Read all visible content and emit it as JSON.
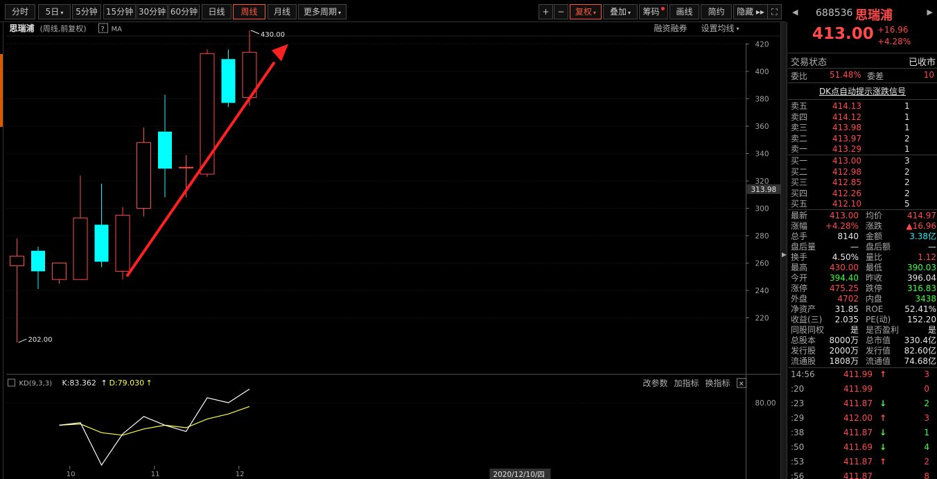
{
  "toolbar": {
    "left": [
      {
        "label": "分时",
        "active": false
      },
      {
        "label": "5日",
        "active": false,
        "dropdown": true
      },
      {
        "label": "5分钟",
        "active": false
      },
      {
        "label": "15分钟",
        "active": false
      },
      {
        "label": "30分钟",
        "active": false
      },
      {
        "label": "60分钟",
        "active": false
      },
      {
        "label": "日线",
        "active": false
      },
      {
        "label": "周线",
        "active": true
      },
      {
        "label": "月线",
        "active": false
      },
      {
        "label": "更多周期",
        "active": false,
        "dropdown": true
      }
    ],
    "right": [
      {
        "label": "+",
        "active": false
      },
      {
        "label": "−",
        "active": false
      },
      {
        "label": "复权",
        "active": true,
        "dropdown": true
      },
      {
        "label": "叠加",
        "active": false,
        "dropdown": true
      },
      {
        "label": "筹码",
        "active": false,
        "dot": true
      },
      {
        "label": "画线",
        "active": false
      },
      {
        "label": "简约",
        "active": false
      },
      {
        "label": "隐藏 ▸▸",
        "active": false
      },
      {
        "label": "⛶",
        "active": false
      }
    ]
  },
  "chart_header": {
    "name": "思瑞浦",
    "info": "(周线,前复权)",
    "help": "?",
    "ma": "MA",
    "margin": "融资融券",
    "settings": "设置均线"
  },
  "kd_header": {
    "label": "KD(9,3,3)",
    "k": "K:83.362",
    "d": "D:79.030",
    "btn1": "改参数",
    "btn2": "加指标",
    "btn3": "换指标",
    "close": "✕"
  },
  "chart_data": {
    "type": "candlestick",
    "ylim": [
      190,
      440
    ],
    "yticks": [
      220,
      240,
      260,
      280,
      300,
      320,
      340,
      360,
      380,
      400,
      420
    ],
    "current_price_label": "313.98",
    "high_label": "430.00",
    "low_label": "202.00",
    "xtick_labels": [
      {
        "label": "10",
        "index": 2.5
      },
      {
        "label": "11",
        "index": 6.5
      },
      {
        "label": "12",
        "index": 10.5
      }
    ],
    "date_label": "2020/12/10/四",
    "candles": [
      {
        "o": 258,
        "h": 278,
        "l": 202,
        "c": 265
      },
      {
        "o": 269,
        "h": 272,
        "l": 241,
        "c": 254
      },
      {
        "o": 248,
        "h": 260,
        "l": 245,
        "c": 260
      },
      {
        "o": 248,
        "h": 324,
        "l": 248,
        "c": 293
      },
      {
        "o": 288,
        "h": 318,
        "l": 257,
        "c": 261
      },
      {
        "o": 254,
        "h": 301,
        "l": 248,
        "c": 295
      },
      {
        "o": 300,
        "h": 359,
        "l": 294,
        "c": 348
      },
      {
        "o": 356,
        "h": 383,
        "l": 308,
        "c": 329
      },
      {
        "o": 330,
        "h": 339,
        "l": 308,
        "c": 330
      },
      {
        "o": 325,
        "h": 416,
        "l": 323,
        "c": 413
      },
      {
        "o": 409,
        "h": 416,
        "l": 374,
        "c": 377
      },
      {
        "o": 381,
        "h": 430,
        "l": 375,
        "c": 414
      }
    ],
    "kd": {
      "ytick": "80.00",
      "ytick_value": 80,
      "ylim": [
        20,
        100
      ],
      "k": [
        null,
        null,
        null,
        62,
        64,
        30,
        55,
        69,
        62,
        57,
        84,
        80,
        91
      ],
      "d": [
        null,
        null,
        null,
        62,
        63,
        56,
        54,
        59,
        62,
        60,
        67,
        71,
        77
      ]
    }
  },
  "right": {
    "code": "688536",
    "name": "思瑞浦",
    "price": "413.00",
    "change": "+16.96",
    "pct": "+4.28%",
    "status_label": "交易状态",
    "status_value": "已收市",
    "weibi_label": "委比",
    "weibi_value": "51.48%",
    "weicha_label": "委差",
    "weicha_value": "10",
    "dk_link": "DK点自动提示涨跌信号",
    "asks": [
      {
        "label": "卖五",
        "price": "414.13",
        "vol": "1"
      },
      {
        "label": "卖四",
        "price": "414.12",
        "vol": "1"
      },
      {
        "label": "卖三",
        "price": "413.98",
        "vol": "1"
      },
      {
        "label": "卖二",
        "price": "413.97",
        "vol": "2"
      },
      {
        "label": "卖一",
        "price": "413.29",
        "vol": "1"
      }
    ],
    "bids": [
      {
        "label": "买一",
        "price": "413.00",
        "vol": "3"
      },
      {
        "label": "买二",
        "price": "412.98",
        "vol": "2"
      },
      {
        "label": "买三",
        "price": "412.85",
        "vol": "2"
      },
      {
        "label": "买四",
        "price": "412.26",
        "vol": "2"
      },
      {
        "label": "买五",
        "price": "412.10",
        "vol": "5"
      }
    ],
    "quotes": [
      {
        "l1": "最新",
        "v1": "413.00",
        "c1": "red",
        "l2": "均价",
        "v2": "414.97",
        "c2": "red"
      },
      {
        "l1": "涨幅",
        "v1": "+4.28%",
        "c1": "red",
        "l2": "涨跌",
        "v2": "▲16.96",
        "c2": "red"
      },
      {
        "l1": "总手",
        "v1": "8140",
        "c1": "wht",
        "l2": "金额",
        "v2": "3.38亿",
        "c2": "cyan"
      },
      {
        "l1": "盘后量",
        "v1": "—",
        "c1": "wht",
        "l2": "盘后额",
        "v2": "—",
        "c2": "wht"
      },
      {
        "l1": "换手",
        "v1": "4.50%",
        "c1": "wht",
        "l2": "量比",
        "v2": "1.12",
        "c2": "red"
      },
      {
        "l1": "最高",
        "v1": "430.00",
        "c1": "red",
        "l2": "最低",
        "v2": "390.03",
        "c2": "grn"
      },
      {
        "l1": "今开",
        "v1": "394.40",
        "c1": "grn",
        "l2": "昨收",
        "v2": "396.04",
        "c2": "wht"
      },
      {
        "l1": "涨停",
        "v1": "475.25",
        "c1": "red",
        "l2": "跌停",
        "v2": "316.83",
        "c2": "grn"
      },
      {
        "l1": "外盘",
        "v1": "4702",
        "c1": "red",
        "l2": "内盘",
        "v2": "3438",
        "c2": "grn"
      },
      {
        "l1": "净资产",
        "v1": "31.85",
        "c1": "wht",
        "l2": "ROE",
        "v2": "52.41%",
        "c2": "wht"
      },
      {
        "l1": "收益(三)",
        "v1": "2.035",
        "c1": "wht",
        "l2": "PE(动)",
        "v2": "152.20",
        "c2": "wht"
      },
      {
        "l1": "同股同权",
        "v1": "是",
        "c1": "wht",
        "l2": "是否盈利",
        "v2": "是",
        "c2": "wht"
      },
      {
        "l1": "总股本",
        "v1": "8000万",
        "c1": "wht",
        "l2": "总市值",
        "v2": "330.4亿",
        "c2": "wht"
      },
      {
        "l1": "发行股",
        "v1": "2000万",
        "c1": "wht",
        "l2": "发行值",
        "v2": "82.60亿",
        "c2": "wht"
      },
      {
        "l1": "流通股",
        "v1": "1808万",
        "c1": "wht",
        "l2": "流通值",
        "v2": "74.68亿",
        "c2": "wht"
      }
    ],
    "ticks": [
      {
        "time": "14:56",
        "price": "411.99",
        "arrow": "↑",
        "dir": "up",
        "vol": "3"
      },
      {
        "time": ":20",
        "price": "411.99",
        "arrow": "",
        "dir": "up",
        "vol": "0"
      },
      {
        "time": ":23",
        "price": "411.87",
        "arrow": "↓",
        "dir": "down",
        "vol": "2"
      },
      {
        "time": ":29",
        "price": "412.00",
        "arrow": "↑",
        "dir": "up",
        "vol": "3"
      },
      {
        "time": ":38",
        "price": "411.87",
        "arrow": "↓",
        "dir": "down",
        "vol": "1"
      },
      {
        "time": ":50",
        "price": "411.69",
        "arrow": "↓",
        "dir": "down",
        "vol": "4"
      },
      {
        "time": ":53",
        "price": "411.87",
        "arrow": "↑",
        "dir": "up",
        "vol": "2"
      },
      {
        "time": ":56",
        "price": "411.87",
        "arrow": "",
        "dir": "up",
        "vol": "8"
      }
    ]
  },
  "colors": {
    "up": "#ff4a4a",
    "down": "#00ffff",
    "k_line": "#ffffff",
    "d_line": "#ffff40",
    "arrow": "#ff2020",
    "grid": "#3a2020"
  }
}
